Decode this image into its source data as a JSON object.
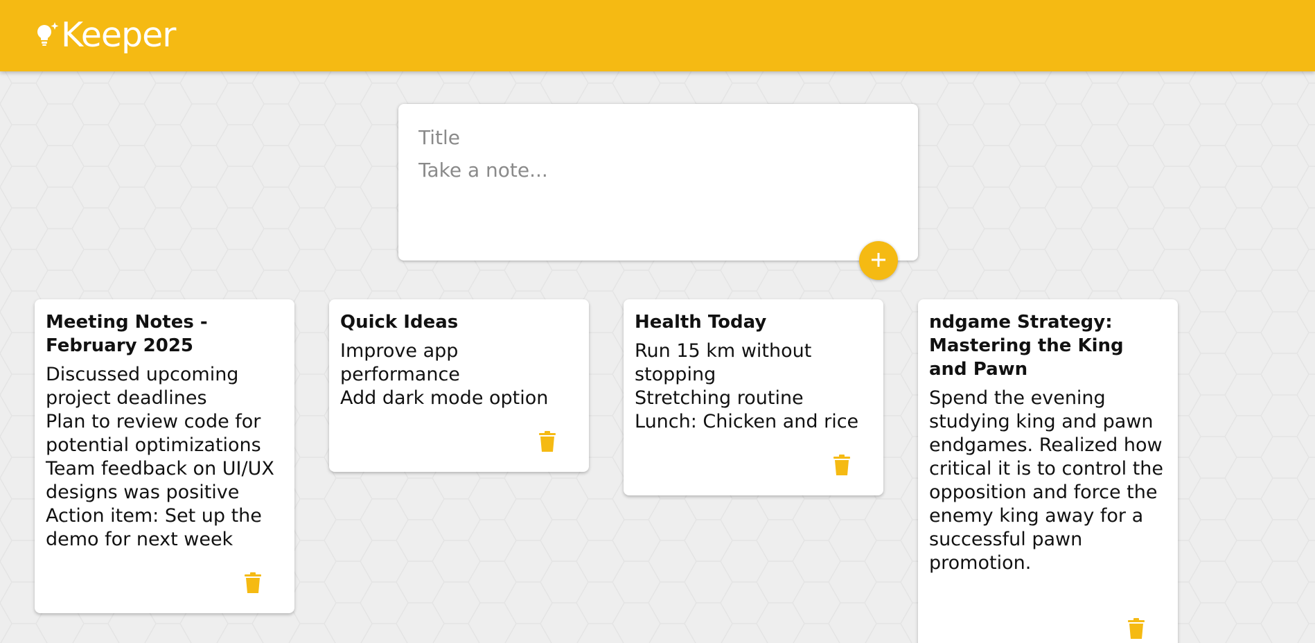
{
  "header": {
    "brand_name": "Keeper",
    "brand_icon": "lightbulb-sparkle-icon",
    "accent_color": "#f5ba13"
  },
  "composer": {
    "title_placeholder": "Title",
    "content_placeholder": "Take a note...",
    "add_icon": "plus-icon"
  },
  "notes": [
    {
      "title": "Meeting Notes - February 2025",
      "content": "Discussed upcoming project deadlines\nPlan to review code for potential optimizations\nTeam feedback on UI/UX designs was positive\nAction item: Set up the demo for next week",
      "delete_icon": "trash-icon"
    },
    {
      "title": "Quick Ideas",
      "content": "Improve app performance\nAdd dark mode option",
      "delete_icon": "trash-icon"
    },
    {
      "title": "Health Today",
      "content": "Run 15 km without stopping\nStretching routine\nLunch: Chicken and rice",
      "delete_icon": "trash-icon"
    },
    {
      "title": "ndgame Strategy: Mastering the King and Pawn",
      "content": "Spend the evening studying king and pawn endgames. Realized how critical it is to control the opposition and force the enemy king away for a successful pawn promotion.",
      "delete_icon": "trash-icon"
    }
  ]
}
